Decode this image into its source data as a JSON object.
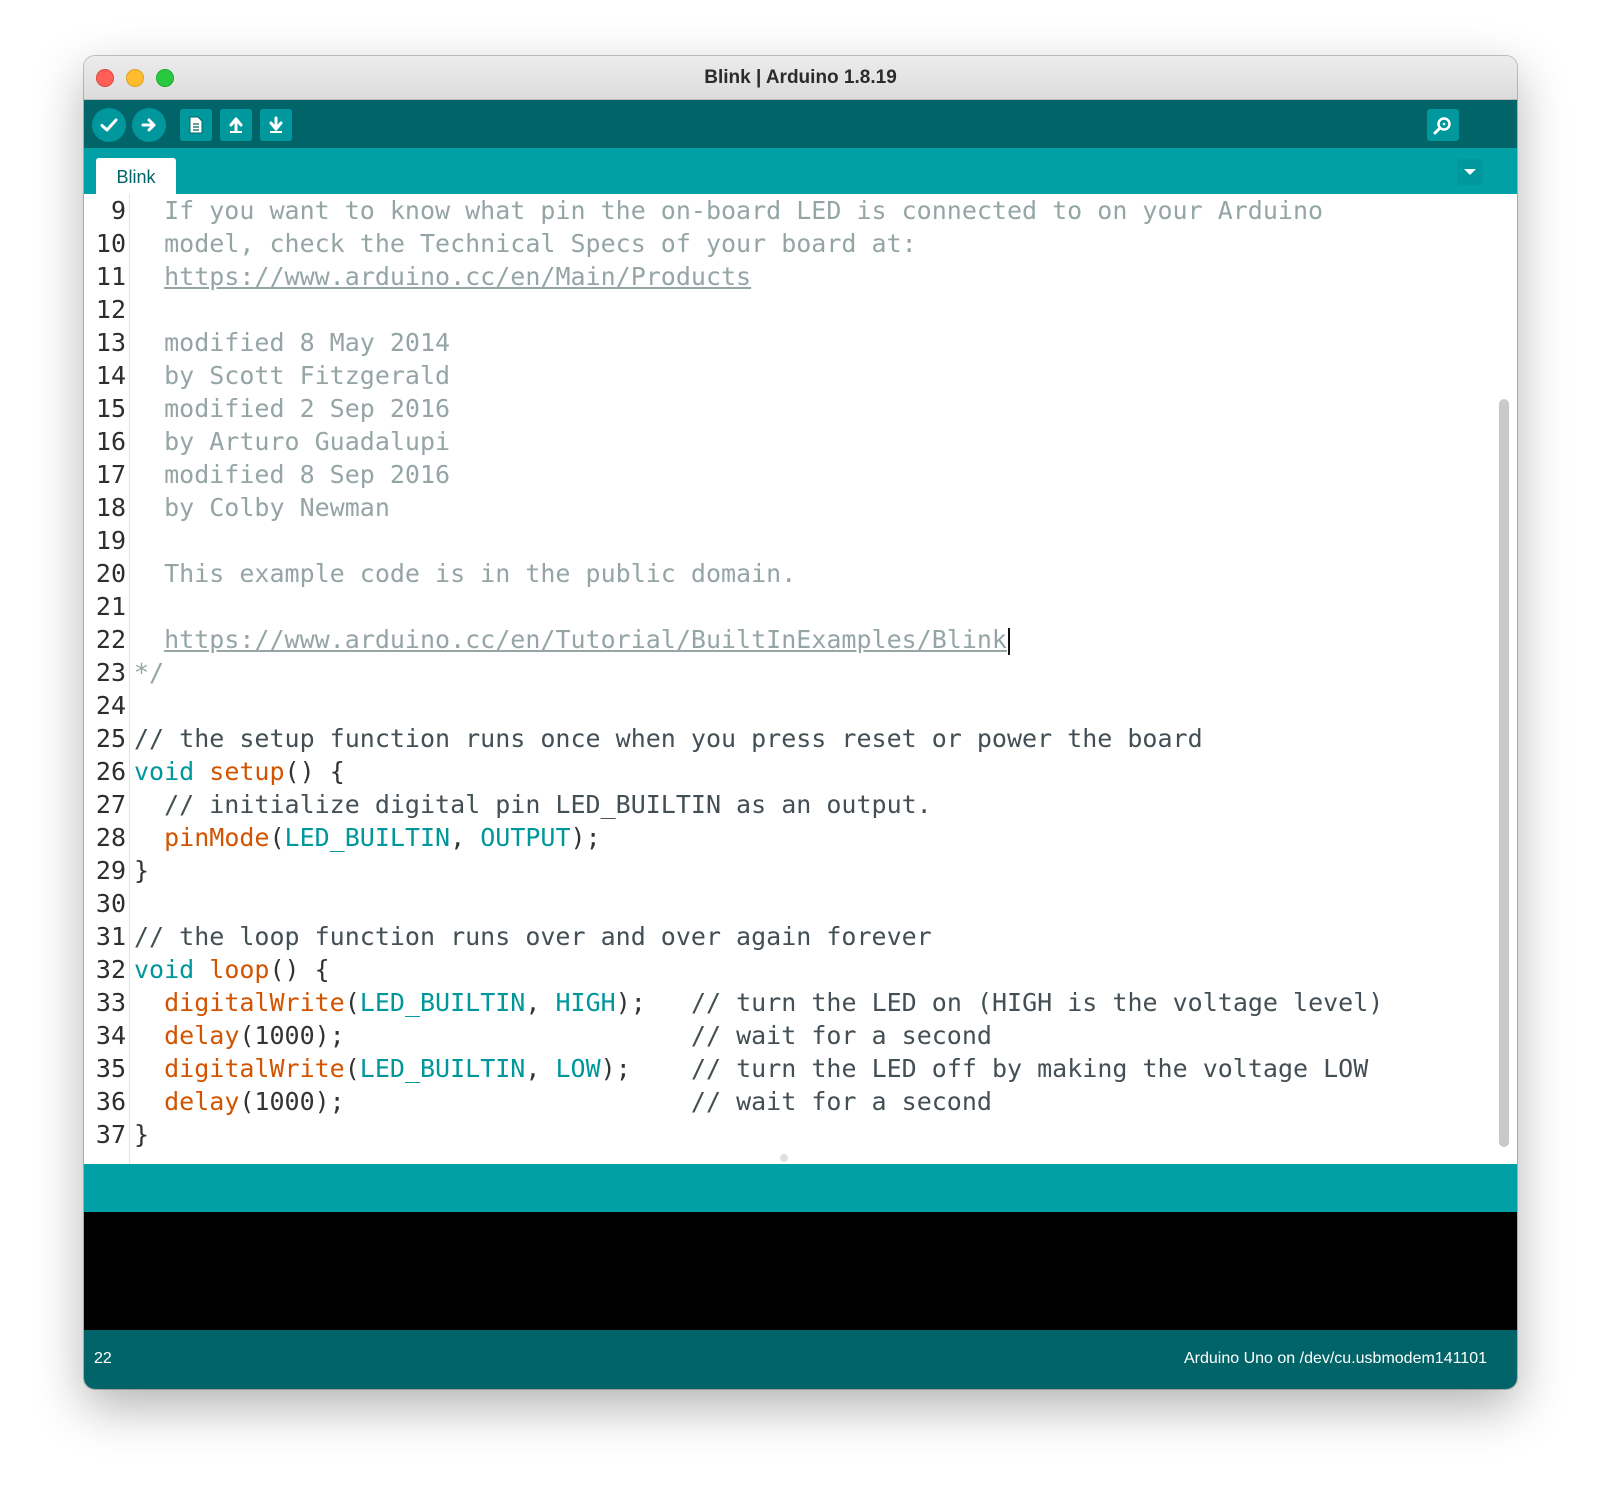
{
  "window": {
    "title": "Blink | Arduino 1.8.19"
  },
  "toolbar": {
    "buttons": [
      {
        "name": "verify",
        "icon": "check-icon"
      },
      {
        "name": "upload",
        "icon": "arrow-right-icon"
      },
      {
        "name": "new",
        "icon": "document-icon"
      },
      {
        "name": "open",
        "icon": "arrow-up-icon"
      },
      {
        "name": "save",
        "icon": "arrow-down-icon"
      },
      {
        "name": "serial-monitor",
        "icon": "magnifier-icon"
      }
    ]
  },
  "tabs": [
    {
      "label": "Blink",
      "active": true
    }
  ],
  "editor": {
    "cursor_line": 22,
    "lines": [
      {
        "n": "9",
        "tokens": [
          {
            "t": "  If you want to know what pin the on-board LED is connected to on your Arduino",
            "c": "comment"
          }
        ]
      },
      {
        "n": "10",
        "tokens": [
          {
            "t": "  model, check the Technical Specs of your board at:",
            "c": "comment"
          }
        ]
      },
      {
        "n": "11",
        "tokens": [
          {
            "t": "  ",
            "c": "comment"
          },
          {
            "t": "https://www.arduino.cc/en/Main/Products",
            "c": "link"
          }
        ]
      },
      {
        "n": "12",
        "tokens": []
      },
      {
        "n": "13",
        "tokens": [
          {
            "t": "  modified 8 May 2014",
            "c": "comment"
          }
        ]
      },
      {
        "n": "14",
        "tokens": [
          {
            "t": "  by Scott Fitzgerald",
            "c": "comment"
          }
        ]
      },
      {
        "n": "15",
        "tokens": [
          {
            "t": "  modified 2 Sep 2016",
            "c": "comment"
          }
        ]
      },
      {
        "n": "16",
        "tokens": [
          {
            "t": "  by Arturo Guadalupi",
            "c": "comment"
          }
        ]
      },
      {
        "n": "17",
        "tokens": [
          {
            "t": "  modified 8 Sep 2016",
            "c": "comment"
          }
        ]
      },
      {
        "n": "18",
        "tokens": [
          {
            "t": "  by Colby Newman",
            "c": "comment"
          }
        ]
      },
      {
        "n": "19",
        "tokens": []
      },
      {
        "n": "20",
        "tokens": [
          {
            "t": "  This example code is in the public domain.",
            "c": "comment"
          }
        ]
      },
      {
        "n": "21",
        "tokens": []
      },
      {
        "n": "22",
        "tokens": [
          {
            "t": "  ",
            "c": "comment"
          },
          {
            "t": "https://www.arduino.cc/en/Tutorial/BuiltInExamples/Blink",
            "c": "link"
          }
        ],
        "caret": true
      },
      {
        "n": "23",
        "tokens": [
          {
            "t": "*/",
            "c": "comment"
          }
        ]
      },
      {
        "n": "24",
        "tokens": []
      },
      {
        "n": "25",
        "tokens": [
          {
            "t": "// the setup function runs once when you press reset or power the board",
            "c": "comment2"
          }
        ]
      },
      {
        "n": "26",
        "tokens": [
          {
            "t": "void",
            "c": "kw"
          },
          {
            "t": " ",
            "c": "plain"
          },
          {
            "t": "setup",
            "c": "fn"
          },
          {
            "t": "() {",
            "c": "plain"
          }
        ]
      },
      {
        "n": "27",
        "tokens": [
          {
            "t": "  // initialize digital pin LED_BUILTIN as an output.",
            "c": "comment2"
          }
        ]
      },
      {
        "n": "28",
        "tokens": [
          {
            "t": "  ",
            "c": "plain"
          },
          {
            "t": "pinMode",
            "c": "bi"
          },
          {
            "t": "(",
            "c": "plain"
          },
          {
            "t": "LED_BUILTIN",
            "c": "const"
          },
          {
            "t": ", ",
            "c": "plain"
          },
          {
            "t": "OUTPUT",
            "c": "const"
          },
          {
            "t": ");",
            "c": "plain"
          }
        ]
      },
      {
        "n": "29",
        "tokens": [
          {
            "t": "}",
            "c": "plain"
          }
        ]
      },
      {
        "n": "30",
        "tokens": []
      },
      {
        "n": "31",
        "tokens": [
          {
            "t": "// the loop function runs over and over again forever",
            "c": "comment2"
          }
        ]
      },
      {
        "n": "32",
        "tokens": [
          {
            "t": "void",
            "c": "kw"
          },
          {
            "t": " ",
            "c": "plain"
          },
          {
            "t": "loop",
            "c": "fn"
          },
          {
            "t": "() {",
            "c": "plain"
          }
        ]
      },
      {
        "n": "33",
        "tokens": [
          {
            "t": "  ",
            "c": "plain"
          },
          {
            "t": "digitalWrite",
            "c": "bi"
          },
          {
            "t": "(",
            "c": "plain"
          },
          {
            "t": "LED_BUILTIN",
            "c": "const"
          },
          {
            "t": ", ",
            "c": "plain"
          },
          {
            "t": "HIGH",
            "c": "const"
          },
          {
            "t": ");   ",
            "c": "plain"
          },
          {
            "t": "// turn the LED on (HIGH is the voltage level)",
            "c": "comment2"
          }
        ]
      },
      {
        "n": "34",
        "tokens": [
          {
            "t": "  ",
            "c": "plain"
          },
          {
            "t": "delay",
            "c": "bi"
          },
          {
            "t": "(1000);                       ",
            "c": "plain"
          },
          {
            "t": "// wait for a second",
            "c": "comment2"
          }
        ]
      },
      {
        "n": "35",
        "tokens": [
          {
            "t": "  ",
            "c": "plain"
          },
          {
            "t": "digitalWrite",
            "c": "bi"
          },
          {
            "t": "(",
            "c": "plain"
          },
          {
            "t": "LED_BUILTIN",
            "c": "const"
          },
          {
            "t": ", ",
            "c": "plain"
          },
          {
            "t": "LOW",
            "c": "const"
          },
          {
            "t": ");    ",
            "c": "plain"
          },
          {
            "t": "// turn the LED off by making the voltage LOW",
            "c": "comment2"
          }
        ]
      },
      {
        "n": "36",
        "tokens": [
          {
            "t": "  ",
            "c": "plain"
          },
          {
            "t": "delay",
            "c": "bi"
          },
          {
            "t": "(1000);                       ",
            "c": "plain"
          },
          {
            "t": "// wait for a second",
            "c": "comment2"
          }
        ]
      },
      {
        "n": "37",
        "tokens": [
          {
            "t": "}",
            "c": "plain"
          }
        ]
      }
    ]
  },
  "message_bar": {
    "text": ""
  },
  "status": {
    "line_number": "22",
    "board": "Arduino Uno on /dev/cu.usbmodem141101"
  },
  "colors": {
    "toolbar": "#006468",
    "tabbar": "#00a0a6",
    "button": "#00979d",
    "console": "#000000"
  }
}
